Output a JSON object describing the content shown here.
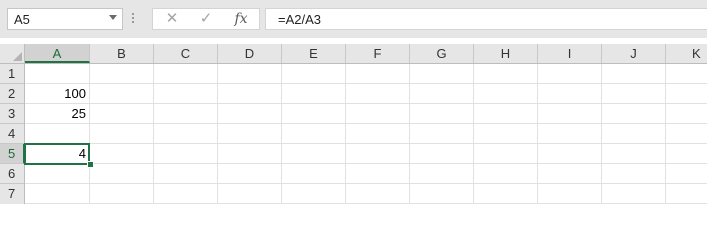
{
  "name_box": {
    "value": "A5"
  },
  "formula_bar": {
    "cancel_icon": "✕",
    "enter_icon": "✓",
    "fx_label": "fx",
    "formula": "=A2/A3"
  },
  "columns": [
    "A",
    "B",
    "C",
    "D",
    "E",
    "F",
    "G",
    "H",
    "I",
    "J",
    "K"
  ],
  "rows": [
    "1",
    "2",
    "3",
    "4",
    "5",
    "6",
    "7"
  ],
  "cells": {
    "A2": "100",
    "A3": "25",
    "A5": "4"
  },
  "selection": {
    "active_cell": "A5",
    "column": "A",
    "row": "5"
  },
  "colors": {
    "accent": "#217346",
    "header_bg": "#e6e6e6",
    "gridline": "#e1e1e1"
  }
}
